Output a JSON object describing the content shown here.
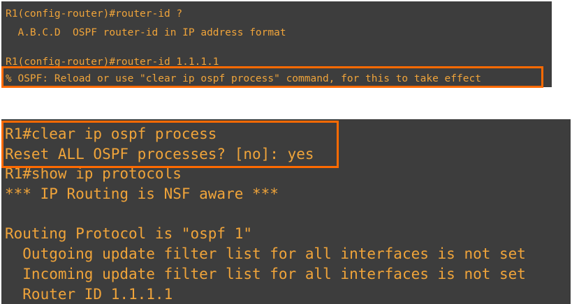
{
  "colors": {
    "terminal_bg": "#3d3d3d",
    "terminal_text": "#f0a43a",
    "highlight_border": "#ff6a00",
    "page_bg": "#ffffff"
  },
  "top_terminal": {
    "lines": [
      "R1(config-router)#router-id ?",
      "  A.B.C.D  OSPF router-id in IP address format",
      "",
      "R1(config-router)#router-id 1.1.1.1",
      "% OSPF: Reload or use \"clear ip ospf process\" command, for this to take effect"
    ]
  },
  "bottom_terminal": {
    "lines": [
      "R1#clear ip ospf process",
      "Reset ALL OSPF processes? [no]: yes",
      "R1#show ip protocols",
      "*** IP Routing is NSF aware ***",
      "",
      "Routing Protocol is \"ospf 1\"",
      "  Outgoing update filter list for all interfaces is not set",
      "  Incoming update filter list for all interfaces is not set",
      "  Router ID 1.1.1.1"
    ]
  }
}
